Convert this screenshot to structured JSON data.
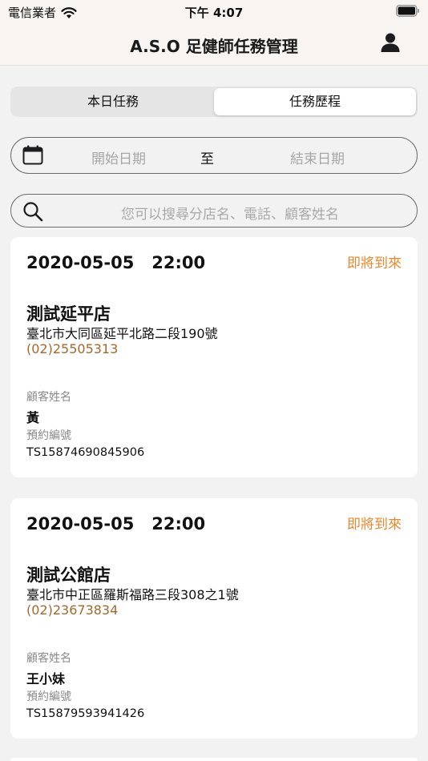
{
  "status_bar": {
    "carrier": "電信業者",
    "time": "下午 4:07"
  },
  "nav": {
    "title": "A.S.O 足健師任務管理"
  },
  "tabs": [
    {
      "label": "本日任務",
      "active": false
    },
    {
      "label": "任務歷程",
      "active": true
    }
  ],
  "date_range": {
    "start_placeholder": "開始日期",
    "separator": "至",
    "end_placeholder": "結束日期"
  },
  "search": {
    "placeholder": "您可以搜尋分店名、電話、顧客姓名"
  },
  "labels": {
    "customer_name": "顧客姓名",
    "booking_no": "預約編號"
  },
  "tasks": [
    {
      "date": "2020-05-05",
      "time": "22:00",
      "status": "即將到來",
      "store": "測試延平店",
      "address": "臺北市大同區延平北路二段190號",
      "phone": "(02)25505313",
      "customer": "黃",
      "booking_no": "TS15874690845906"
    },
    {
      "date": "2020-05-05",
      "time": "22:00",
      "status": "即將到來",
      "store": "測試公館店",
      "address": "臺北市中正區羅斯福路三段308之1號",
      "phone": "(02)23673834",
      "customer": "王小妹",
      "booking_no": "TS15879593941426"
    }
  ],
  "colors": {
    "status": "#e8892e",
    "phone": "#a5682a",
    "background": "#f2f2f2"
  },
  "icons": {
    "wifi": "wifi-icon",
    "battery": "battery-icon",
    "profile": "person-icon",
    "calendar": "calendar-icon",
    "search": "search-icon"
  }
}
